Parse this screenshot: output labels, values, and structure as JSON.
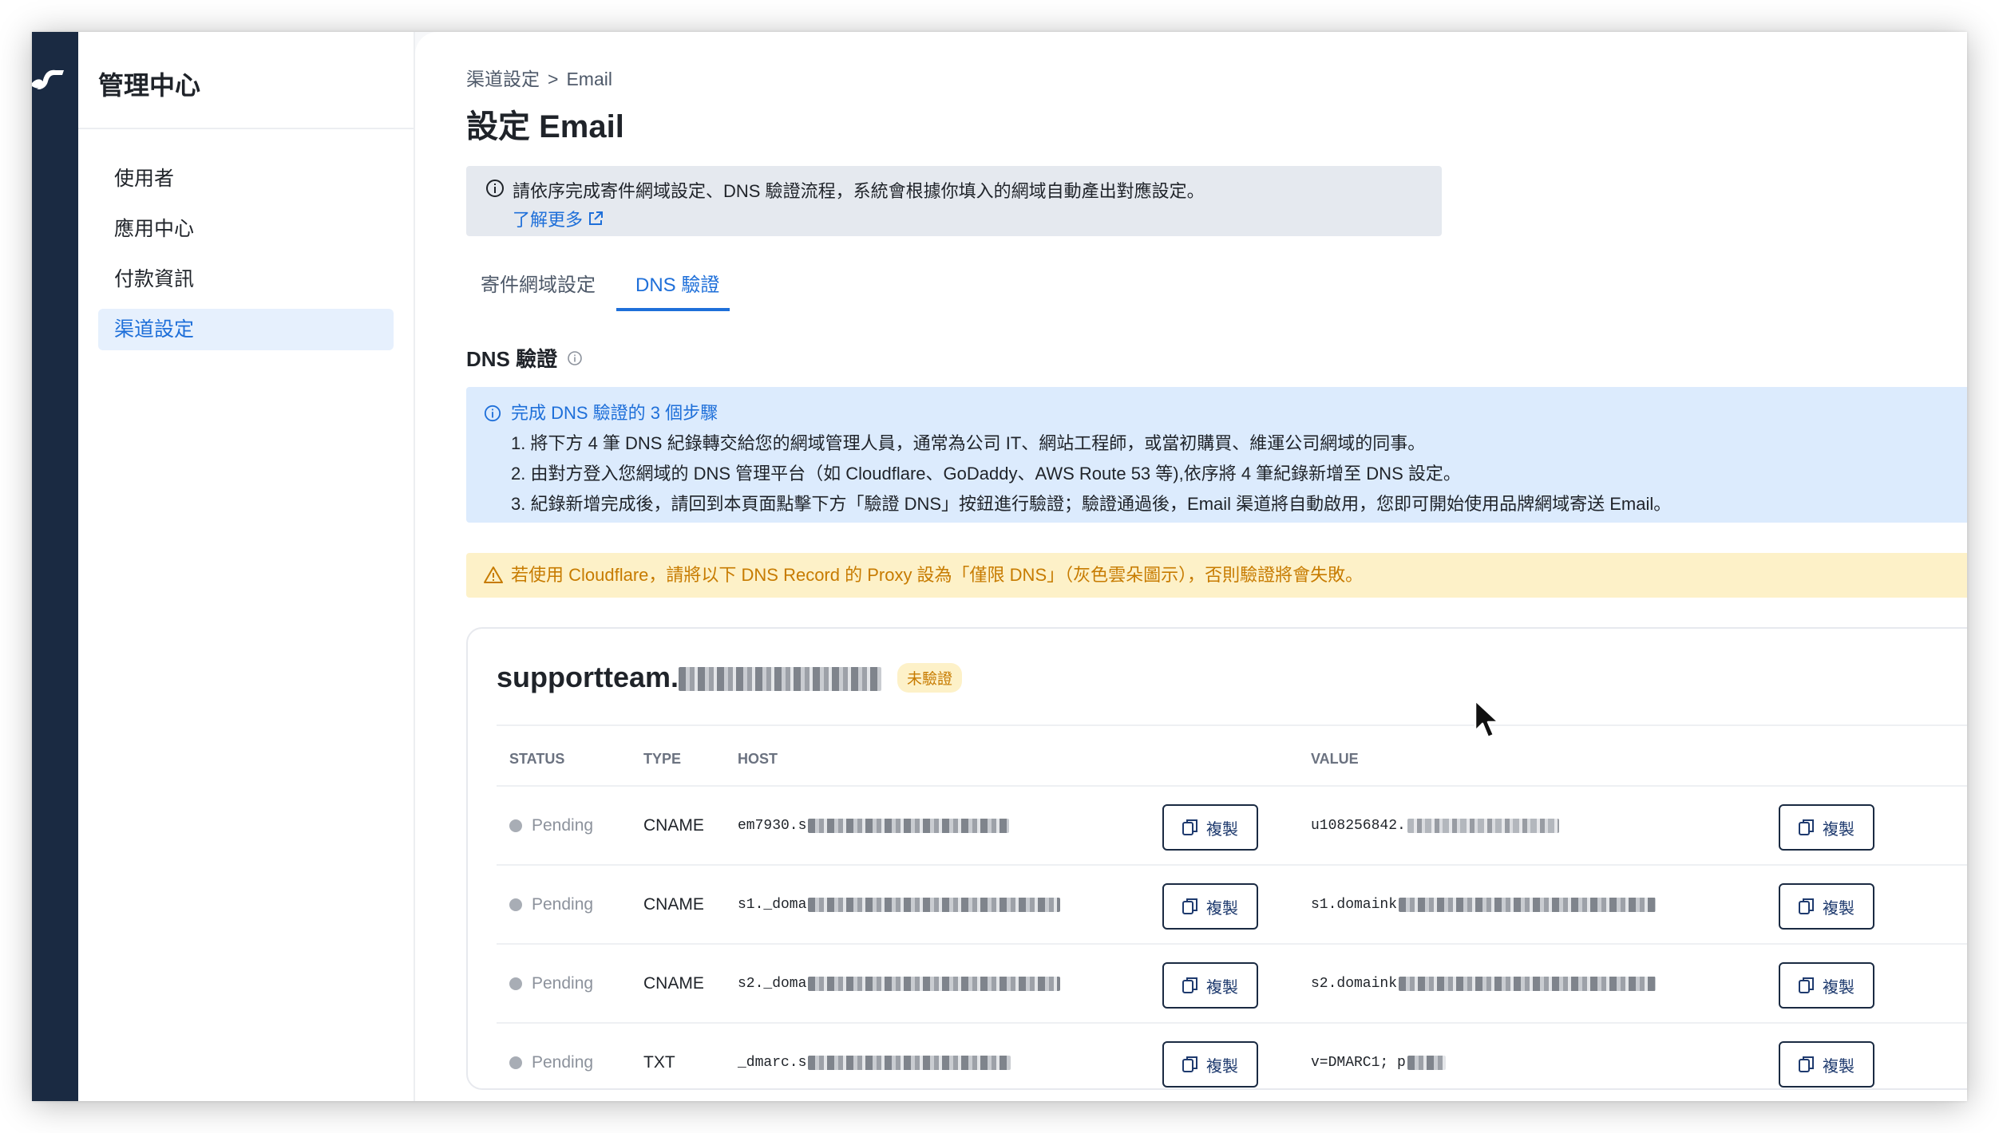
{
  "sidebar": {
    "title": "管理中心",
    "items": [
      {
        "label": "使用者",
        "active": false
      },
      {
        "label": "應用中心",
        "active": false
      },
      {
        "label": "付款資訊",
        "active": false
      },
      {
        "label": "渠道設定",
        "active": true
      }
    ]
  },
  "breadcrumb": {
    "parent": "渠道設定",
    "separator": ">",
    "current": "Email"
  },
  "page_title": "設定 Email",
  "info_banner": {
    "text": "請依序完成寄件網域設定、DNS 驗證流程，系統會根據你填入的網域自動產出對應設定。",
    "link": "了解更多"
  },
  "tabs": [
    {
      "label": "寄件網域設定",
      "active": false
    },
    {
      "label": "DNS 驗證",
      "active": true
    }
  ],
  "section_title": "DNS 驗證",
  "steps": {
    "heading": "完成 DNS 驗證的 3 個步驟",
    "items": [
      "1. 將下方 4 筆 DNS 紀錄轉交給您的網域管理人員，通常為公司 IT、網站工程師，或當初購買、維運公司網域的同事。",
      "2. 由對方登入您網域的 DNS 管理平台（如 Cloudflare、GoDaddy、AWS Route 53 等),依序將 4 筆紀錄新增至 DNS 設定。",
      "3. 紀錄新增完成後，請回到本頁面點擊下方「驗證 DNS」按鈕進行驗證；驗證通過後，Email 渠道將自動啟用，您即可開始使用品牌網域寄送 Email。"
    ]
  },
  "warning": "若使用 Cloudflare，請將以下 DNS Record 的 Proxy 設為「僅限 DNS」（灰色雲朵圖示），否則驗證將會失敗。",
  "domain_card": {
    "domain_prefix": "supportteam.",
    "status_badge": "未驗證",
    "columns": {
      "status": "STATUS",
      "type": "TYPE",
      "host": "HOST",
      "value": "VALUE"
    },
    "copy_label": "複製",
    "records": [
      {
        "status": "Pending",
        "type": "CNAME",
        "host": "em7930.s",
        "value": "u108256842."
      },
      {
        "status": "Pending",
        "type": "CNAME",
        "host": "s1._doma",
        "value": "s1.domaink"
      },
      {
        "status": "Pending",
        "type": "CNAME",
        "host": "s2._doma",
        "value": "s2.domaink"
      },
      {
        "status": "Pending",
        "type": "TXT",
        "host": "_dmarc.s",
        "value": "v=DMARC1; p"
      }
    ]
  },
  "colors": {
    "accent": "#1e6fd9",
    "rail": "#1a2a42",
    "warning": "#c77b00",
    "info_bg": "#dcebfd"
  }
}
